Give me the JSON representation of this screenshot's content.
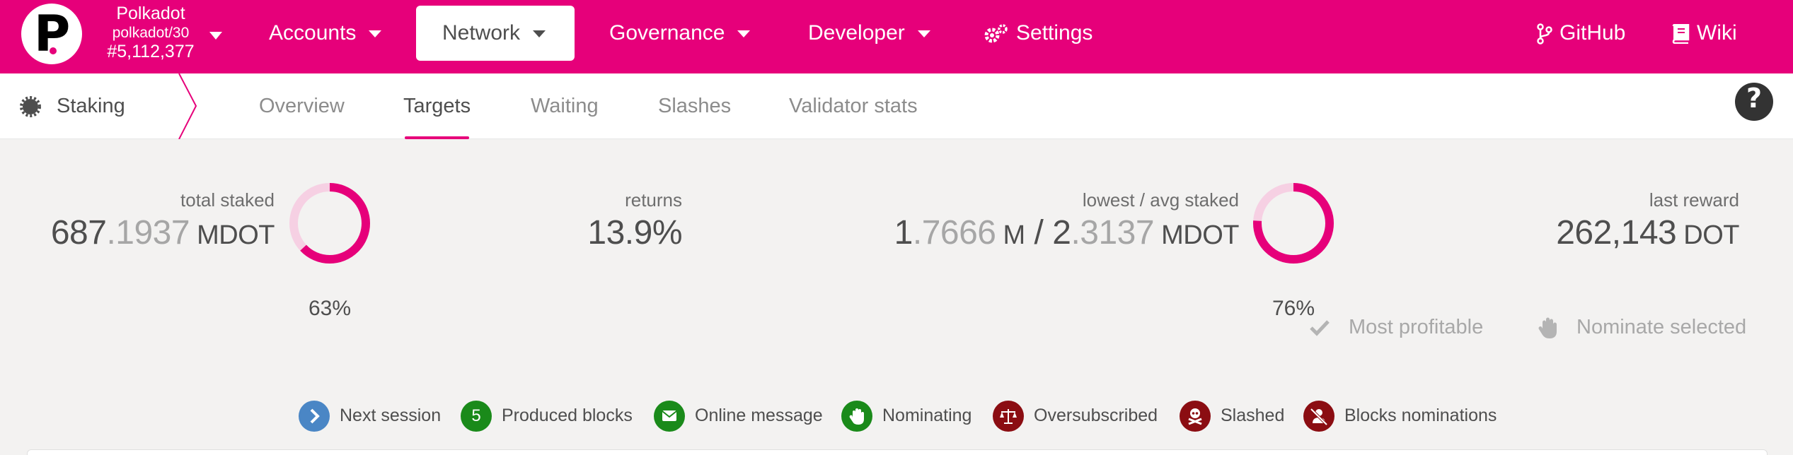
{
  "header": {
    "chain_name": "Polkadot",
    "chain_version": "polkadot/30",
    "block_number": "#5,112,377",
    "nav": [
      {
        "label": "Accounts"
      },
      {
        "label": "Network"
      },
      {
        "label": "Governance"
      },
      {
        "label": "Developer"
      },
      {
        "label": "Settings"
      }
    ],
    "links": [
      {
        "label": "GitHub"
      },
      {
        "label": "Wiki"
      }
    ]
  },
  "subnav": {
    "section": "Staking",
    "tabs": [
      {
        "label": "Overview"
      },
      {
        "label": "Targets"
      },
      {
        "label": "Waiting"
      },
      {
        "label": "Slashes"
      },
      {
        "label": "Validator stats"
      }
    ],
    "active_tab": "Targets",
    "help": "?"
  },
  "summary": {
    "total_staked": {
      "label": "total staked",
      "int": "687",
      "frac": ".1937",
      "unit": " MDOT",
      "percent": "63%",
      "fraction": 0.63
    },
    "returns": {
      "label": "returns",
      "value": "13.9%"
    },
    "lowest_avg": {
      "label": "lowest / avg staked",
      "low_int": "1",
      "low_frac": ".7666",
      "low_unit": " M",
      "sep": " / ",
      "avg_int": "2",
      "avg_frac": ".3137",
      "avg_unit": " MDOT",
      "percent": "76%",
      "fraction": 0.76
    },
    "last_reward": {
      "label": "last reward",
      "value": "262,143",
      "unit": " DOT"
    }
  },
  "actions": {
    "most_profitable": "Most profitable",
    "nominate_selected": "Nominate selected"
  },
  "legend": [
    {
      "label": "Next session",
      "badge_text": "",
      "color": "#4a86c5",
      "icon": "chevron-right-icon"
    },
    {
      "label": "Produced blocks",
      "badge_text": "5",
      "color": "#1a8a1a",
      "icon": ""
    },
    {
      "label": "Online message",
      "badge_text": "",
      "color": "#1a8a1a",
      "icon": "envelope-icon"
    },
    {
      "label": "Nominating",
      "badge_text": "",
      "color": "#1a8a1a",
      "icon": "hand-icon"
    },
    {
      "label": "Oversubscribed",
      "badge_text": "",
      "color": "#8b0d12",
      "icon": "balance-scale-icon"
    },
    {
      "label": "Slashed",
      "badge_text": "",
      "color": "#8b0d12",
      "icon": "skull-crossbones-icon"
    },
    {
      "label": "Blocks nominations",
      "badge_text": "",
      "color": "#8b0d12",
      "icon": "user-slash-icon"
    }
  ],
  "colors": {
    "brand": "#e6007a",
    "track": "#f6d0e3"
  }
}
